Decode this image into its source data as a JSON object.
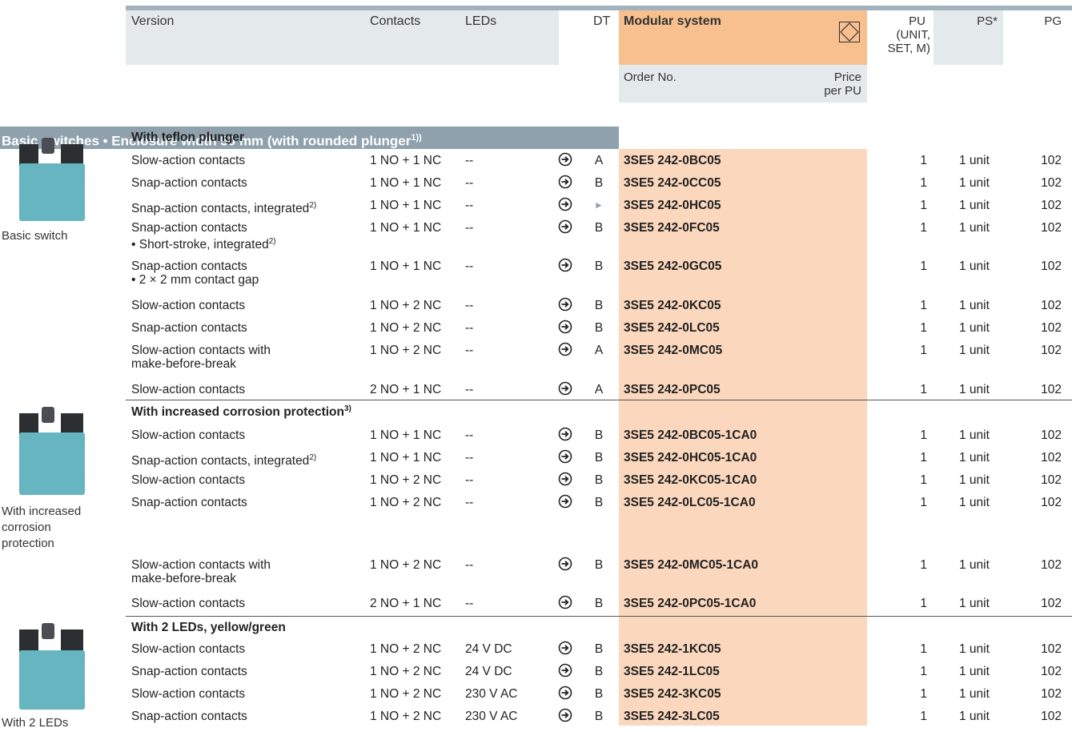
{
  "header": {
    "version": "Version",
    "contacts": "Contacts",
    "leds": "LEDs",
    "dt": "DT",
    "modular_system": "Modular system",
    "pu": "PU",
    "pu_sub": "(UNIT,",
    "pu_sub2": "SET, M)",
    "ps": "PS*",
    "pg": "PG",
    "order_no": "Order No.",
    "price": "Price",
    "per_pu": "per PU",
    "modular_icon": "diamond-box-icon"
  },
  "section": {
    "title": "Basic switches • Enclosure width 50 mm (with rounded plunger",
    "sup": "1))"
  },
  "groups": [
    {
      "title": "With teflon plunger",
      "sup": "",
      "caption": [
        "Basic switch"
      ]
    },
    {
      "title": "With increased corrosion protection",
      "sup": "3)",
      "caption": [
        "With increased",
        "corrosion",
        "protection"
      ]
    },
    {
      "title": "With 2 LEDs, yellow/green",
      "sup": "",
      "caption": [
        "With 2 LEDs"
      ]
    }
  ],
  "rows": [
    {
      "v1": "Slow-action contacts",
      "v1sup": "",
      "v2": "",
      "v2sup": "",
      "contacts": "1 NO + 1 NC",
      "leds": "--",
      "dt": "A",
      "order": "3SE5 242-0BC05",
      "pu": "1",
      "ps": "1 unit",
      "pg": "102"
    },
    {
      "v1": "Snap-action contacts",
      "v1sup": "",
      "v2": "",
      "v2sup": "",
      "contacts": "1 NO + 1 NC",
      "leds": "--",
      "dt": "B",
      "order": "3SE5 242-0CC05",
      "pu": "1",
      "ps": "1 unit",
      "pg": "102"
    },
    {
      "v1": "Snap-action contacts, integrated",
      "v1sup": "2)",
      "v2": "",
      "v2sup": "",
      "contacts": "1 NO + 1 NC",
      "leds": "--",
      "dt": "►",
      "order": "3SE5 242-0HC05",
      "pu": "1",
      "ps": "1 unit",
      "pg": "102"
    },
    {
      "v1": "Snap-action contacts",
      "v1sup": "",
      "v2": "• Short-stroke, integrated",
      "v2sup": "2)",
      "contacts": "1 NO + 1 NC",
      "leds": "--",
      "dt": "B",
      "order": "3SE5 242-0FC05",
      "pu": "1",
      "ps": "1 unit",
      "pg": "102"
    },
    {
      "v1": "Snap-action contacts",
      "v1sup": "",
      "v2": "• 2 × 2 mm contact gap",
      "v2sup": "",
      "contacts": "1 NO + 1 NC",
      "leds": "--",
      "dt": "B",
      "order": "3SE5 242-0GC05",
      "pu": "1",
      "ps": "1 unit",
      "pg": "102"
    },
    {
      "v1": "Slow-action contacts",
      "v1sup": "",
      "v2": "",
      "v2sup": "",
      "contacts": "1 NO + 2 NC",
      "leds": "--",
      "dt": "B",
      "order": "3SE5 242-0KC05",
      "pu": "1",
      "ps": "1 unit",
      "pg": "102"
    },
    {
      "v1": "Snap-action contacts",
      "v1sup": "",
      "v2": "",
      "v2sup": "",
      "contacts": "1 NO + 2 NC",
      "leds": "--",
      "dt": "B",
      "order": "3SE5 242-0LC05",
      "pu": "1",
      "ps": "1 unit",
      "pg": "102"
    },
    {
      "v1": "Slow-action contacts with",
      "v1sup": "",
      "v2": "make-before-break",
      "v2sup": "",
      "contacts": "1 NO + 2 NC",
      "leds": "--",
      "dt": "A",
      "order": "3SE5 242-0MC05",
      "pu": "1",
      "ps": "1 unit",
      "pg": "102"
    },
    {
      "v1": "Slow-action contacts",
      "v1sup": "",
      "v2": "",
      "v2sup": "",
      "contacts": "2 NO + 1 NC",
      "leds": "--",
      "dt": "A",
      "order": "3SE5 242-0PC05",
      "pu": "1",
      "ps": "1 unit",
      "pg": "102"
    },
    {
      "v1": "Slow-action contacts",
      "v1sup": "",
      "v2": "",
      "v2sup": "",
      "contacts": "1 NO + 1 NC",
      "leds": "--",
      "dt": "B",
      "order": "3SE5 242-0BC05-1CA0",
      "pu": "1",
      "ps": "1 unit",
      "pg": "102"
    },
    {
      "v1": "Snap-action contacts, integrated",
      "v1sup": "2)",
      "v2": "",
      "v2sup": "",
      "contacts": "1 NO + 1 NC",
      "leds": "--",
      "dt": "B",
      "order": "3SE5 242-0HC05-1CA0",
      "pu": "1",
      "ps": "1 unit",
      "pg": "102"
    },
    {
      "v1": "Slow-action contacts",
      "v1sup": "",
      "v2": "",
      "v2sup": "",
      "contacts": "1 NO + 2 NC",
      "leds": "--",
      "dt": "B",
      "order": "3SE5 242-0KC05-1CA0",
      "pu": "1",
      "ps": "1 unit",
      "pg": "102"
    },
    {
      "v1": "Snap-action contacts",
      "v1sup": "",
      "v2": "",
      "v2sup": "",
      "contacts": "1 NO + 2 NC",
      "leds": "--",
      "dt": "B",
      "order": "3SE5 242-0LC05-1CA0",
      "pu": "1",
      "ps": "1 unit",
      "pg": "102"
    },
    {
      "v1": "Slow-action contacts with",
      "v1sup": "",
      "v2": "make-before-break",
      "v2sup": "",
      "contacts": "1 NO + 2 NC",
      "leds": "--",
      "dt": "B",
      "order": "3SE5 242-0MC05-1CA0",
      "pu": "1",
      "ps": "1 unit",
      "pg": "102"
    },
    {
      "v1": "Slow-action contacts",
      "v1sup": "",
      "v2": "",
      "v2sup": "",
      "contacts": "2 NO + 1 NC",
      "leds": "--",
      "dt": "B",
      "order": "3SE5 242-0PC05-1CA0",
      "pu": "1",
      "ps": "1 unit",
      "pg": "102"
    },
    {
      "v1": "Slow-action contacts",
      "v1sup": "",
      "v2": "",
      "v2sup": "",
      "contacts": "1 NO + 2 NC",
      "leds": "24 V DC",
      "dt": "B",
      "order": "3SE5 242-1KC05",
      "pu": "1",
      "ps": "1 unit",
      "pg": "102"
    },
    {
      "v1": "Snap-action contacts",
      "v1sup": "",
      "v2": "",
      "v2sup": "",
      "contacts": "1 NO + 2 NC",
      "leds": "24 V DC",
      "dt": "B",
      "order": "3SE5 242-1LC05",
      "pu": "1",
      "ps": "1 unit",
      "pg": "102"
    },
    {
      "v1": "Slow-action contacts",
      "v1sup": "",
      "v2": "",
      "v2sup": "",
      "contacts": "1 NO + 2 NC",
      "leds": "230 V AC",
      "dt": "B",
      "order": "3SE5 242-3KC05",
      "pu": "1",
      "ps": "1 unit",
      "pg": "102"
    },
    {
      "v1": "Snap-action contacts",
      "v1sup": "",
      "v2": "",
      "v2sup": "",
      "contacts": "1 NO + 2 NC",
      "leds": "230 V AC",
      "dt": "B",
      "order": "3SE5 242-3LC05",
      "pu": "1",
      "ps": "1 unit",
      "pg": "102"
    }
  ],
  "icons": {
    "arrow": "circle-arrow-right-icon",
    "arrow_glyph": "➔"
  }
}
